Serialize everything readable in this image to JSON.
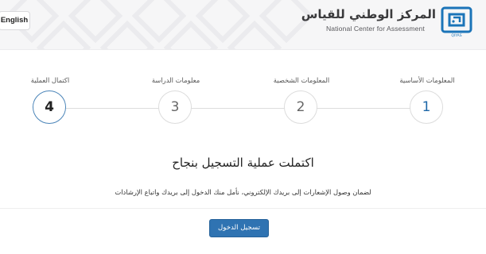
{
  "header": {
    "language_button": "English",
    "org_name_ar": "المركز الوطني للقياس",
    "org_name_en": "National Center for Assessment",
    "logo_caption": "QIYAS"
  },
  "steps": [
    {
      "number": "1",
      "label": "المعلومات الأساسية",
      "state": "completed"
    },
    {
      "number": "2",
      "label": "المعلومات الشخصية",
      "state": "completed"
    },
    {
      "number": "3",
      "label": "معلومات الدراسة",
      "state": "completed"
    },
    {
      "number": "4",
      "label": "اكتمال العملية",
      "state": "current"
    }
  ],
  "message": {
    "title": "اكتملت عملية التسجيل بنجاح",
    "subtitle": "لضمان وصول الإشعارات إلى بريدك الإلكتروني، نأمل منك الدخول إلى بريدك واتباع الإرشادات"
  },
  "actions": {
    "login_label": "تسجيل الدخول"
  },
  "colors": {
    "primary": "#2f73b2",
    "step_number_blue": "#1d67a8",
    "logo_blue": "#1b74b8",
    "header_bg": "#f6f6f7"
  }
}
